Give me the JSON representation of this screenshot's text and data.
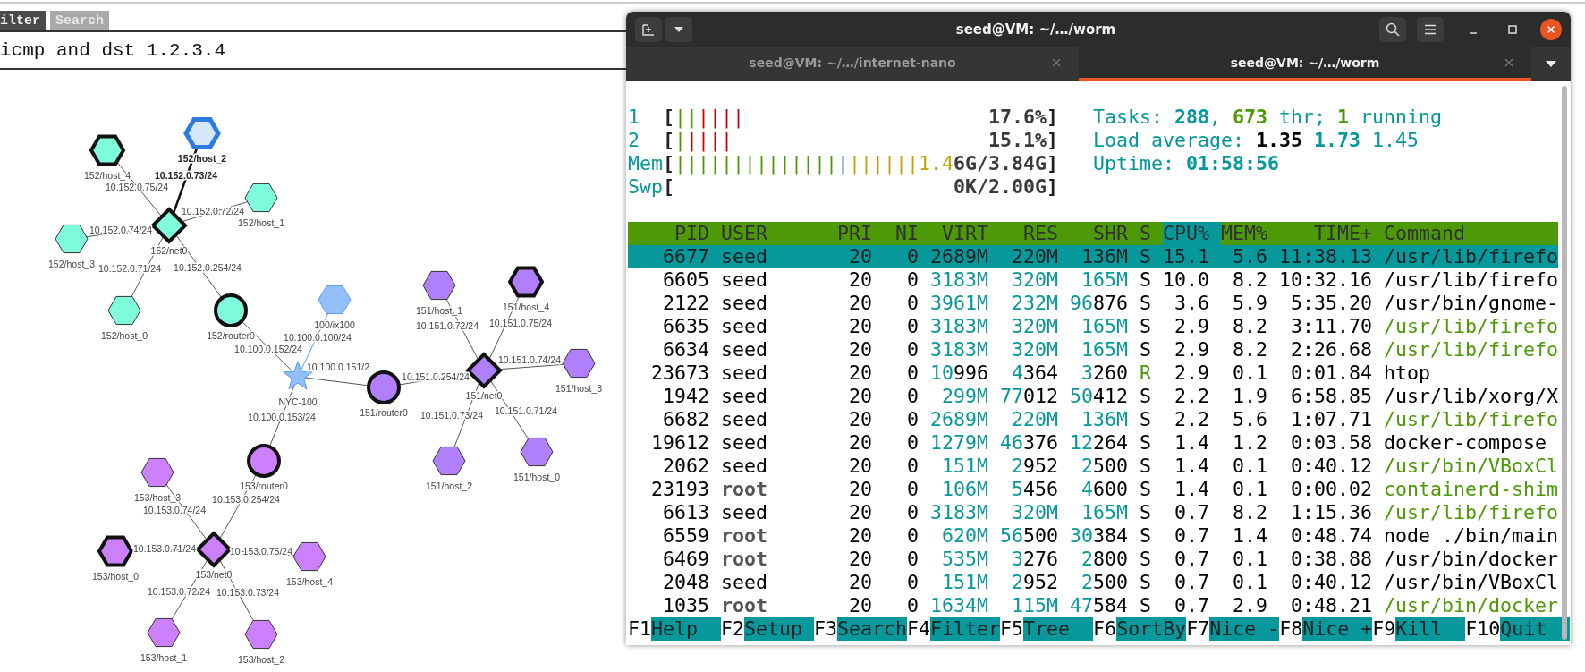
{
  "filter_tabs": [
    {
      "label": "ilter",
      "selected": true
    },
    {
      "label": "Search",
      "selected": false
    }
  ],
  "filter_input": {
    "value": "icmp and dst 1.2.3.4"
  },
  "graph": {
    "nodes": [
      {
        "label": "NYC-100",
        "kind": "star",
        "color": "#93bffb",
        "selected": false,
        "marked": false,
        "children": [
          {
            "label": "152/router0",
            "kind": "router",
            "link": "10.100.0.152/24",
            "color": "#7ffcdc",
            "selected": false,
            "marked": true,
            "children": [
              {
                "label": "152/net0",
                "kind": "switch",
                "link": "10.152.0.254/24",
                "color": "#7ffcdc",
                "selected": false,
                "marked": true,
                "children": [
                  {
                    "label": "152/host_4",
                    "kind": "host",
                    "link": "10.152.0.75/24",
                    "color": "#7ffcdc",
                    "selected": false,
                    "marked": true
                  },
                  {
                    "label": "152/host_2",
                    "kind": "host",
                    "link": "10.152.0.73/24",
                    "color": "#d6e6fc",
                    "selected": true,
                    "marked": false
                  },
                  {
                    "label": "152/host_1",
                    "kind": "host",
                    "link": "10.152.0.72/24",
                    "color": "#7ffcdc",
                    "selected": false,
                    "marked": false
                  },
                  {
                    "label": "152/host_3",
                    "kind": "host",
                    "link": "10.152.0.74/24",
                    "color": "#7ffcdc",
                    "selected": false,
                    "marked": false
                  },
                  {
                    "label": "152/host_0",
                    "kind": "host",
                    "link": "10.152.0.71/24",
                    "color": "#7ffcdc",
                    "selected": false,
                    "marked": false
                  }
                ]
              }
            ]
          },
          {
            "label": "100/ix100",
            "kind": "host",
            "link": "10.100.0.100/24",
            "color": "#93bffb",
            "selected": false,
            "marked": false
          },
          {
            "label": "151/router0",
            "kind": "router",
            "link": "10.100.0.151/2",
            "color": "#b080fc",
            "selected": false,
            "marked": true,
            "children": [
              {
                "label": "151/net0",
                "kind": "switch",
                "link": "10.151.0.254/24",
                "color": "#b080fc",
                "selected": false,
                "marked": true,
                "children": [
                  {
                    "label": "151/host_1",
                    "kind": "host",
                    "link": "10.151.0.72/24",
                    "color": "#b080fc",
                    "selected": false,
                    "marked": false
                  },
                  {
                    "label": "151/host_4",
                    "kind": "host",
                    "link": "10.151.0.75/24",
                    "color": "#b080fc",
                    "selected": false,
                    "marked": true
                  },
                  {
                    "label": "151/host_3",
                    "kind": "host",
                    "link": "10.151.0.74/24",
                    "color": "#b080fc",
                    "selected": false,
                    "marked": false
                  },
                  {
                    "label": "151/host_2",
                    "kind": "host",
                    "link": "10.151.0.73/24",
                    "color": "#b080fc",
                    "selected": false,
                    "marked": false
                  },
                  {
                    "label": "151/host_0",
                    "kind": "host",
                    "link": "10.151.0.71/24",
                    "color": "#b080fc",
                    "selected": false,
                    "marked": false
                  }
                ]
              }
            ]
          },
          {
            "label": "153/router0",
            "kind": "router",
            "link": "10.100.0.153/24",
            "color": "#cc80fc",
            "selected": false,
            "marked": true,
            "children": [
              {
                "label": "153/net0",
                "kind": "switch",
                "link": "10.153.0.254/24",
                "color": "#cc80fc",
                "selected": false,
                "marked": true,
                "children": [
                  {
                    "label": "153/host_3",
                    "kind": "host",
                    "link": "10.153.0.74/24",
                    "color": "#cc80fc",
                    "selected": false,
                    "marked": false
                  },
                  {
                    "label": "153/host_0",
                    "kind": "host",
                    "link": "10.153.0.71/24",
                    "color": "#cc80fc",
                    "selected": false,
                    "marked": true
                  },
                  {
                    "label": "153/host_4",
                    "kind": "host",
                    "link": "10.153.0.75/24",
                    "color": "#cc80fc",
                    "selected": false,
                    "marked": false
                  },
                  {
                    "label": "153/host_1",
                    "kind": "host",
                    "link": "10.153.0.72/24",
                    "color": "#cc80fc",
                    "selected": false,
                    "marked": false
                  },
                  {
                    "label": "153/host_2",
                    "kind": "host",
                    "link": "10.153.0.73/24",
                    "color": "#cc80fc",
                    "selected": false,
                    "marked": false
                  }
                ]
              }
            ]
          }
        ]
      }
    ]
  },
  "terminal": {
    "title": "seed@VM: ~/…/worm",
    "tabs": [
      {
        "label": "seed@VM: ~/…/internet-nano",
        "selected": false
      },
      {
        "label": "seed@VM: ~/…/worm",
        "selected": true
      }
    ],
    "meters": [
      {
        "label": "1",
        "open": "[",
        "segments": [
          {
            "kind": "normal",
            "text": "||"
          },
          {
            "kind": "kernel",
            "text": "||||"
          }
        ],
        "reading": "17.6%",
        "close": "]"
      },
      {
        "label": "2",
        "open": "[",
        "segments": [
          {
            "kind": "normal",
            "text": "|"
          },
          {
            "kind": "kernel",
            "text": "||||"
          }
        ],
        "reading": "15.1%",
        "close": "]"
      },
      {
        "label": "Mem",
        "open": "[",
        "segments": [
          {
            "kind": "normal",
            "text": "||||||||||||||"
          },
          {
            "kind": "buffers",
            "text": "|"
          },
          {
            "kind": "cache",
            "text": "||||||1.4"
          }
        ],
        "reading": "6G/3.84G",
        "close": "]"
      },
      {
        "label": "Swp",
        "open": "[",
        "reading": "0K/2.00G",
        "close": "]"
      }
    ],
    "info": [
      [
        {
          "text": "Tasks: ",
          "kind": "label"
        },
        {
          "text": "288",
          "kind": "total"
        },
        {
          "text": ", ",
          "kind": "label"
        },
        {
          "text": "673",
          "kind": "threads"
        },
        {
          "text": " thr; ",
          "kind": "label"
        },
        {
          "text": "1",
          "kind": "running"
        },
        {
          "text": " running",
          "kind": "label"
        }
      ],
      [
        {
          "text": "Load average: ",
          "kind": "label"
        },
        {
          "text": "1.35",
          "kind": "load1"
        },
        {
          "text": " 1.73",
          "kind": "load5"
        },
        {
          "text": " 1.45",
          "kind": "load15"
        }
      ],
      [
        {
          "text": "Uptime: ",
          "kind": "label"
        },
        {
          "text": "01:58:56",
          "kind": "uptime"
        }
      ]
    ],
    "columns": [
      {
        "label": "PID",
        "selected": false
      },
      {
        "label": "USER",
        "selected": false
      },
      {
        "label": "PRI",
        "selected": false
      },
      {
        "label": "NI",
        "selected": false
      },
      {
        "label": "VIRT",
        "selected": false
      },
      {
        "label": "RES",
        "selected": false
      },
      {
        "label": "SHR",
        "selected": false
      },
      {
        "label": "S",
        "selected": false
      },
      {
        "label": "CPU%",
        "selected": true
      },
      {
        "label": "MEM%",
        "selected": false
      },
      {
        "label": "TIME+",
        "selected": false
      },
      {
        "label": "Command",
        "selected": false
      }
    ],
    "processes": [
      {
        "cells": [
          "6677",
          "seed",
          "20",
          "0",
          "2689M",
          "220M",
          "136M",
          "S",
          "15.1",
          "5.6",
          "11:38.13",
          "/usr/lib/firefo"
        ],
        "selected": true,
        "other_user": false,
        "running": false,
        "thread": true
      },
      {
        "cells": [
          "6605",
          "seed",
          "20",
          "0",
          "3183M",
          "320M",
          "165M",
          "S",
          "10.0",
          "8.2",
          "10:32.16",
          "/usr/lib/firefo"
        ],
        "selected": false,
        "other_user": false,
        "running": false,
        "thread": false
      },
      {
        "cells": [
          "2122",
          "seed",
          "20",
          "0",
          "3961M",
          "232M",
          "96876",
          "S",
          "3.6",
          "5.9",
          "5:35.20",
          "/usr/bin/gnome-"
        ],
        "selected": false,
        "other_user": false,
        "running": false,
        "thread": false
      },
      {
        "cells": [
          "6635",
          "seed",
          "20",
          "0",
          "3183M",
          "320M",
          "165M",
          "S",
          "2.9",
          "8.2",
          "3:11.70",
          "/usr/lib/firefo"
        ],
        "selected": false,
        "other_user": false,
        "running": false,
        "thread": true
      },
      {
        "cells": [
          "6634",
          "seed",
          "20",
          "0",
          "3183M",
          "320M",
          "165M",
          "S",
          "2.9",
          "8.2",
          "2:26.68",
          "/usr/lib/firefo"
        ],
        "selected": false,
        "other_user": false,
        "running": false,
        "thread": true
      },
      {
        "cells": [
          "23673",
          "seed",
          "20",
          "0",
          "10996",
          "4364",
          "3260",
          "R",
          "2.9",
          "0.1",
          "0:01.84",
          "htop"
        ],
        "selected": false,
        "other_user": false,
        "running": true,
        "thread": false
      },
      {
        "cells": [
          "1942",
          "seed",
          "20",
          "0",
          "299M",
          "77012",
          "50412",
          "S",
          "2.2",
          "1.9",
          "6:58.85",
          "/usr/lib/xorg/X"
        ],
        "selected": false,
        "other_user": false,
        "running": false,
        "thread": false
      },
      {
        "cells": [
          "6682",
          "seed",
          "20",
          "0",
          "2689M",
          "220M",
          "136M",
          "S",
          "2.2",
          "5.6",
          "1:07.71",
          "/usr/lib/firefo"
        ],
        "selected": false,
        "other_user": false,
        "running": false,
        "thread": true
      },
      {
        "cells": [
          "19612",
          "seed",
          "20",
          "0",
          "1279M",
          "46376",
          "12264",
          "S",
          "1.4",
          "1.2",
          "0:03.58",
          "docker-compose"
        ],
        "selected": false,
        "other_user": false,
        "running": false,
        "thread": false
      },
      {
        "cells": [
          "2062",
          "seed",
          "20",
          "0",
          "151M",
          "2952",
          "2500",
          "S",
          "1.4",
          "0.1",
          "0:40.12",
          "/usr/bin/VBoxCl"
        ],
        "selected": false,
        "other_user": false,
        "running": false,
        "thread": true
      },
      {
        "cells": [
          "23193",
          "root",
          "20",
          "0",
          "106M",
          "5456",
          "4600",
          "S",
          "1.4",
          "0.1",
          "0:00.02",
          "containerd-shim"
        ],
        "selected": false,
        "other_user": true,
        "running": false,
        "thread": true
      },
      {
        "cells": [
          "6613",
          "seed",
          "20",
          "0",
          "3183M",
          "320M",
          "165M",
          "S",
          "0.7",
          "8.2",
          "1:15.36",
          "/usr/lib/firefo"
        ],
        "selected": false,
        "other_user": false,
        "running": false,
        "thread": true
      },
      {
        "cells": [
          "6559",
          "root",
          "20",
          "0",
          "620M",
          "56500",
          "30384",
          "S",
          "0.7",
          "1.4",
          "0:48.74",
          "node ./bin/main"
        ],
        "selected": false,
        "other_user": true,
        "running": false,
        "thread": false
      },
      {
        "cells": [
          "6469",
          "root",
          "20",
          "0",
          "535M",
          "3276",
          "2800",
          "S",
          "0.7",
          "0.1",
          "0:38.88",
          "/usr/bin/docker"
        ],
        "selected": false,
        "other_user": true,
        "running": false,
        "thread": false
      },
      {
        "cells": [
          "2048",
          "seed",
          "20",
          "0",
          "151M",
          "2952",
          "2500",
          "S",
          "0.7",
          "0.1",
          "0:40.12",
          "/usr/bin/VBoxCl"
        ],
        "selected": false,
        "other_user": false,
        "running": false,
        "thread": false
      },
      {
        "cells": [
          "1035",
          "root",
          "20",
          "0",
          "1634M",
          "115M",
          "47584",
          "S",
          "0.7",
          "2.9",
          "0:48.21",
          "/usr/bin/docker"
        ],
        "selected": false,
        "other_user": true,
        "running": false,
        "thread": true
      }
    ],
    "function_keys": [
      {
        "key": "F1",
        "label": "Help"
      },
      {
        "key": "F2",
        "label": "Setup"
      },
      {
        "key": "F3",
        "label": "Search"
      },
      {
        "key": "F4",
        "label": "Filter"
      },
      {
        "key": "F5",
        "label": "Tree"
      },
      {
        "key": "F6",
        "label": "SortBy"
      },
      {
        "key": "F7",
        "label": "Nice -"
      },
      {
        "key": "F8",
        "label": "Nice +"
      },
      {
        "key": "F9",
        "label": "Kill"
      },
      {
        "key": "F10",
        "label": "Quit"
      }
    ]
  }
}
